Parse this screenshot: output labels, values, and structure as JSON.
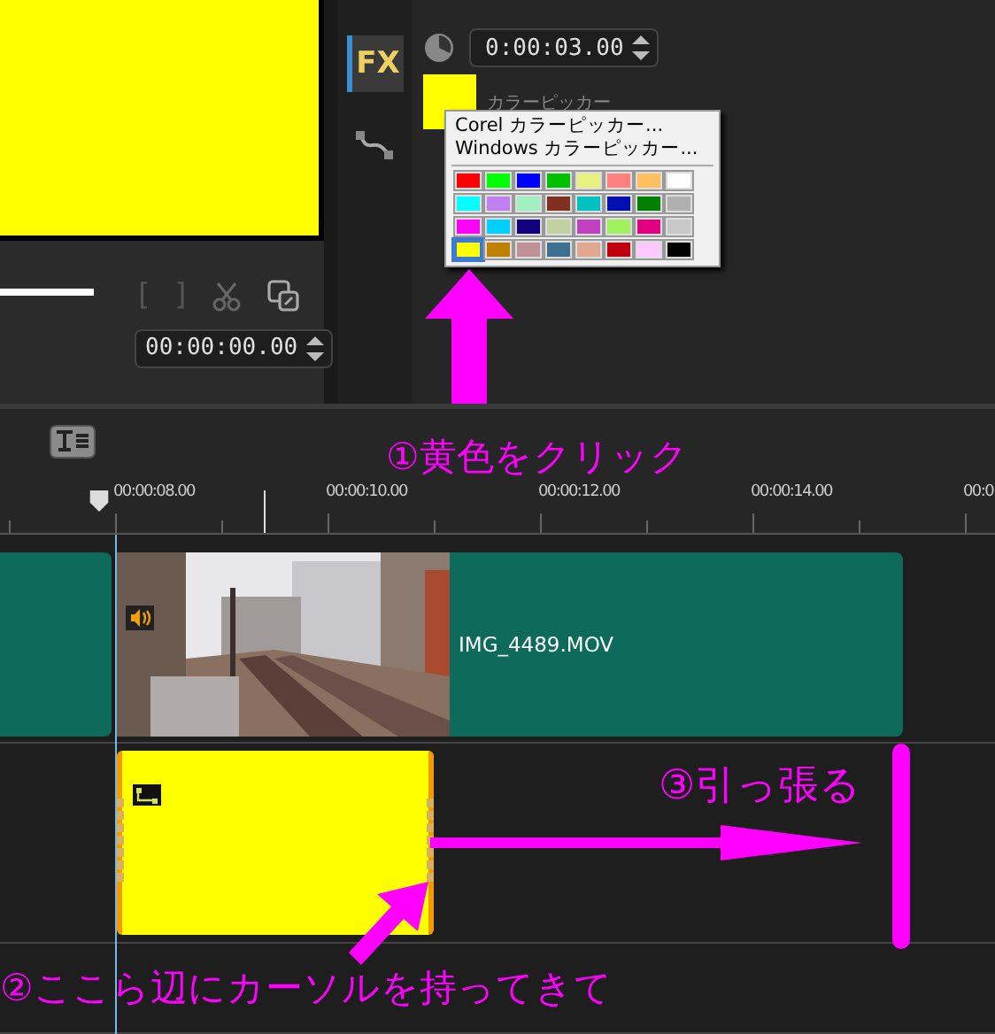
{
  "preview": {
    "timecode": "00:00:00.00",
    "trim_start": "[",
    "trim_end": "]"
  },
  "side_tabs": [
    {
      "kind": "fx",
      "label": "FX",
      "selected": true
    },
    {
      "kind": "path",
      "selected": false
    }
  ],
  "options": {
    "duration": "0:00:03.00",
    "color_label": "カラーピッカー",
    "color": "#ffff00"
  },
  "color_menu": {
    "items": [
      "Corel カラーピッカー...",
      "Windows カラーピッカー..."
    ],
    "swatches": [
      {
        "color": "#ff0000",
        "selected": false
      },
      {
        "color": "#00ff00",
        "selected": false
      },
      {
        "color": "#0000ff",
        "selected": false
      },
      {
        "color": "#00c000",
        "selected": false
      },
      {
        "color": "#e8f080",
        "selected": false
      },
      {
        "color": "#ff8080",
        "selected": false
      },
      {
        "color": "#ffc060",
        "selected": false
      },
      {
        "color": "#ffffff",
        "selected": false
      },
      {
        "color": "#00ffff",
        "selected": false
      },
      {
        "color": "#c080f0",
        "selected": false
      },
      {
        "color": "#a0f0c0",
        "selected": false
      },
      {
        "color": "#803020",
        "selected": false
      },
      {
        "color": "#00c0c0",
        "selected": false
      },
      {
        "color": "#0010b0",
        "selected": false
      },
      {
        "color": "#008000",
        "selected": false
      },
      {
        "color": "#b0b0b0",
        "selected": false
      },
      {
        "color": "#ff00ff",
        "selected": false
      },
      {
        "color": "#00d0ff",
        "selected": false
      },
      {
        "color": "#100080",
        "selected": false
      },
      {
        "color": "#c0d0a0",
        "selected": false
      },
      {
        "color": "#c040c0",
        "selected": false
      },
      {
        "color": "#a0f060",
        "selected": false
      },
      {
        "color": "#e00080",
        "selected": false
      },
      {
        "color": "#c8c8c8",
        "selected": false
      },
      {
        "color": "#ffff00",
        "selected": true
      },
      {
        "color": "#c08000",
        "selected": false
      },
      {
        "color": "#c09098",
        "selected": false
      },
      {
        "color": "#407090",
        "selected": false
      },
      {
        "color": "#e0a890",
        "selected": false
      },
      {
        "color": "#c00010",
        "selected": false
      },
      {
        "color": "#ffc8ff",
        "selected": false
      },
      {
        "color": "#000000",
        "selected": false
      }
    ]
  },
  "ruler": {
    "labels": [
      "00:00:08.00",
      "00:00:10.00",
      "00:00:12.00",
      "00:00:14.00",
      "00:0"
    ]
  },
  "clips": {
    "video": {
      "name": "IMG_4489.MOV"
    },
    "color": {
      "color": "#ffff00"
    }
  },
  "annotations": [
    {
      "kind": "click",
      "text": "①黄色をクリック"
    },
    {
      "kind": "cursor",
      "text": "②ここら辺にカーソルを持ってきて"
    },
    {
      "kind": "drag",
      "text": "③引っ張る"
    }
  ]
}
